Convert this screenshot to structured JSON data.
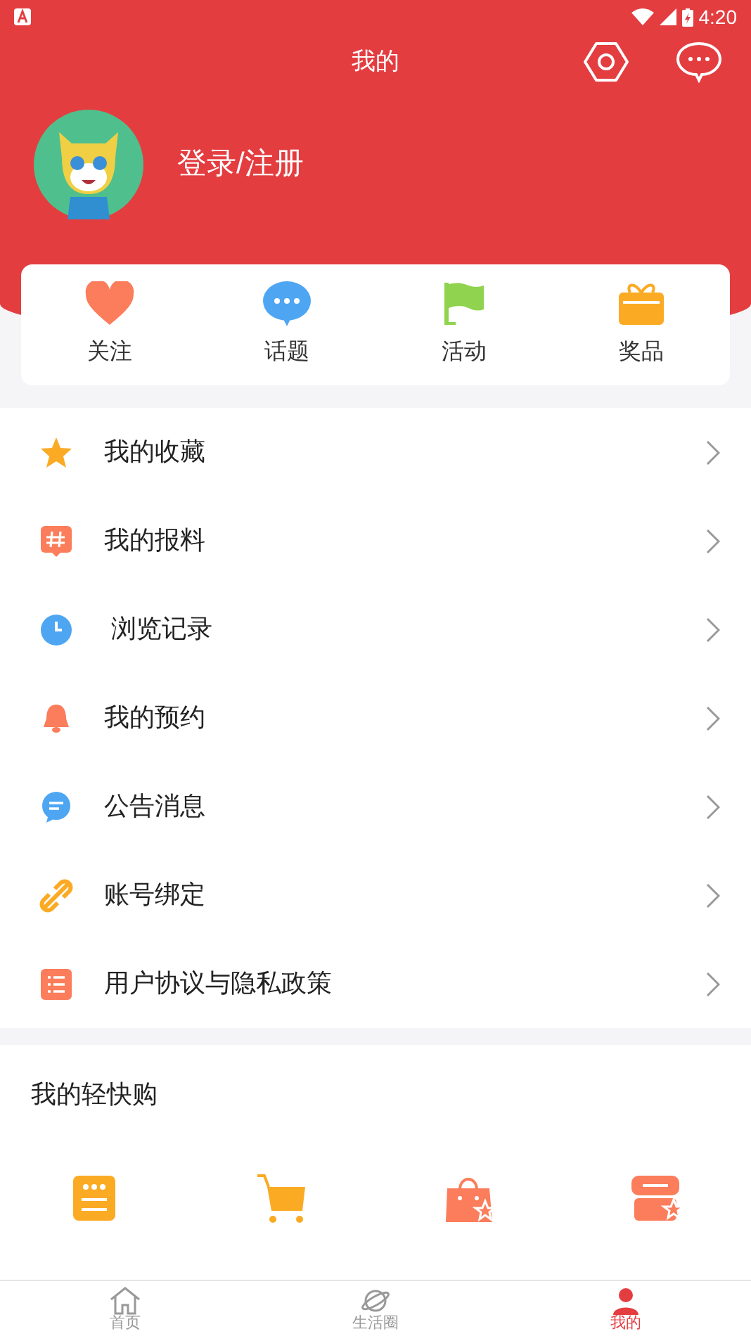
{
  "status_bar": {
    "time": "4:20"
  },
  "header": {
    "title": "我的",
    "login": "登录/注册"
  },
  "quick_links": [
    {
      "kind": "heart",
      "label": "关注"
    },
    {
      "kind": "chat",
      "label": "话题"
    },
    {
      "kind": "flag",
      "label": "活动"
    },
    {
      "kind": "gift",
      "label": "奖品"
    }
  ],
  "menu": [
    {
      "kind": "star",
      "label": "我的收藏"
    },
    {
      "kind": "hash",
      "label": "我的报料"
    },
    {
      "kind": "clock",
      "label": " 浏览记录"
    },
    {
      "kind": "bell",
      "label": "我的预约"
    },
    {
      "kind": "message",
      "label": "公告消息"
    },
    {
      "kind": "link",
      "label": "账号绑定"
    },
    {
      "kind": "list",
      "label": "用户协议与隐私政策"
    }
  ],
  "shop": {
    "title": "我的轻快购",
    "items": [
      {
        "kind": "order"
      },
      {
        "kind": "cart"
      },
      {
        "kind": "bag"
      },
      {
        "kind": "store"
      }
    ]
  },
  "tab_bar": [
    {
      "kind": "home",
      "label": "首页",
      "selected": false
    },
    {
      "kind": "planet",
      "label": "生活圈",
      "selected": false
    },
    {
      "kind": "person",
      "label": "我的",
      "selected": true
    }
  ]
}
